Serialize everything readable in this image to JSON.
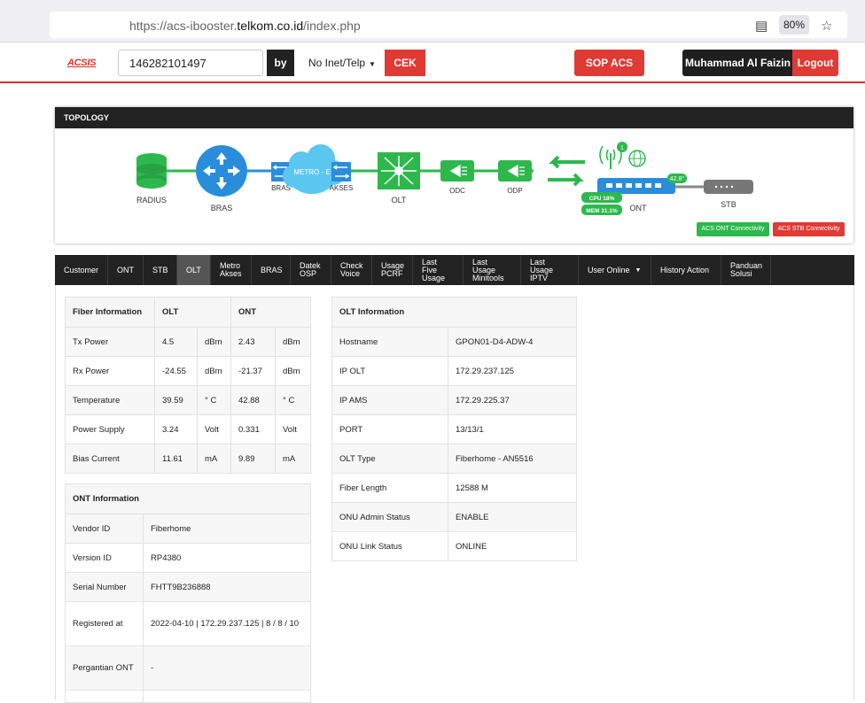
{
  "browser": {
    "url_prefix": "https://acs-ibooster.",
    "url_domain": "telkom.co.id",
    "url_path": "/index.php",
    "zoom": "80%"
  },
  "header": {
    "logo": "ACSIS",
    "search_value": "146282101497",
    "by_label": "by",
    "type_select": "No Inet/Telp",
    "cek_label": "CEK",
    "sop_label": "SOP ACS",
    "user_name": "Muhammad Al Faizin",
    "logout_label": "Logout"
  },
  "topology": {
    "title": "TOPOLOGY",
    "nodes": {
      "radius": "RADIUS",
      "bras": "BRAS",
      "bras_small": "BRAS",
      "metro": "METRO - E",
      "akses": "AKSES",
      "olt": "OLT",
      "odc": "ODC",
      "odp": "ODP",
      "ont": "ONT",
      "stb": "STB"
    },
    "wifi_count": "1",
    "temperature": "42.8°",
    "cpu": "CPU 18%",
    "mem": "MEM 31.1%",
    "acs_ont": "ACS ONT Connectivity",
    "acs_stb": "ACS STB Connectivity"
  },
  "colors": {
    "accent_red": "#e03a35",
    "green": "#2db84d",
    "blue": "#2a8ddb"
  },
  "tabs": [
    {
      "l1": "Customer",
      "l2": ""
    },
    {
      "l1": "ONT",
      "l2": ""
    },
    {
      "l1": "STB",
      "l2": ""
    },
    {
      "l1": "OLT",
      "l2": ""
    },
    {
      "l1": "Metro",
      "l2": "Akses"
    },
    {
      "l1": "BRAS",
      "l2": ""
    },
    {
      "l1": "Datek",
      "l2": "OSP"
    },
    {
      "l1": "Check",
      "l2": "Voice"
    },
    {
      "l1": "Usage",
      "l2": "PCRF"
    },
    {
      "l1": "Last Five",
      "l2": "Usage"
    },
    {
      "l1": "Last Usage",
      "l2": "Minitools"
    },
    {
      "l1": "Last Usage",
      "l2": "IPTV"
    },
    {
      "l1": "User Online",
      "l2": ""
    },
    {
      "l1": "History Action",
      "l2": ""
    },
    {
      "l1": "Panduan",
      "l2": "Solusi"
    }
  ],
  "fiber": {
    "headers": [
      "Fiber Information",
      "OLT",
      "ONT"
    ],
    "rows": [
      {
        "label": "Tx Power",
        "olt": "4.5",
        "olt_unit": "dBm",
        "ont": "2.43",
        "ont_unit": "dBm"
      },
      {
        "label": "Rx Power",
        "olt": "-24.55",
        "olt_unit": "dBm",
        "ont": "-21.37",
        "ont_unit": "dBm"
      },
      {
        "label": "Temperature",
        "olt": "39.59",
        "olt_unit": "° C",
        "ont": "42.88",
        "ont_unit": "° C"
      },
      {
        "label": "Power Supply",
        "olt": "3.24",
        "olt_unit": "Volt",
        "ont": "0.331",
        "ont_unit": "Volt"
      },
      {
        "label": "Bias Current",
        "olt": "11.61",
        "olt_unit": "mA",
        "ont": "9.89",
        "ont_unit": "mA"
      }
    ]
  },
  "ont_info": {
    "title": "ONT Information",
    "rows": [
      {
        "label": "Vendor ID",
        "value": "Fiberhome"
      },
      {
        "label": "Version ID",
        "value": "RP4380"
      },
      {
        "label": "Serial Number",
        "value": "FHTT9B236888"
      },
      {
        "label": "Registered at",
        "value": "2022-04-10 | 172.29.237.125 | 8 / 8 / 10"
      },
      {
        "label": "Pergantian ONT",
        "value": "-"
      }
    ]
  },
  "olt_info": {
    "title": "OLT Information",
    "rows": [
      {
        "label": "Hostname",
        "value": "GPON01-D4-ADW-4"
      },
      {
        "label": "IP OLT",
        "value": "172.29.237.125"
      },
      {
        "label": "IP AMS",
        "value": "172.29.225.37"
      },
      {
        "label": "PORT",
        "value": "13/13/1"
      },
      {
        "label": "OLT Type",
        "value": "Fiberhome - AN5516"
      },
      {
        "label": "Fiber Length",
        "value": "12588 M"
      },
      {
        "label": "ONU Admin Status",
        "value": "ENABLE"
      },
      {
        "label": "ONU Link Status",
        "value": "ONLINE"
      }
    ]
  }
}
